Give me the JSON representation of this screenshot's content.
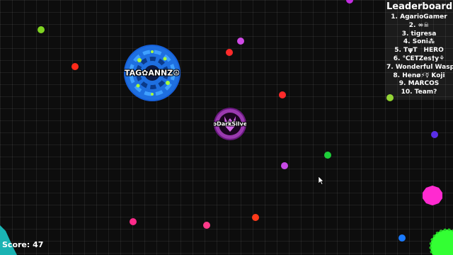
{
  "leaderboard": {
    "title": "Leaderboard",
    "entries": [
      "1. AgarioGamer",
      "2. ∞☠",
      "3. tigresa",
      "4. Soni⁂",
      "5. TψT HERO",
      "6. ℃ETZes†y⚘",
      "7. Wonderful Wasp",
      "8. Henø⚡☿ Koji",
      "9. MARCOS",
      "10. Team?"
    ]
  },
  "hud": {
    "score": "Score: 47"
  },
  "players": [
    {
      "name": "TAG✿ΑΝΝΖ☮",
      "color": "#1e6fe0"
    },
    {
      "name": "toDarkSilver",
      "color": "#9a3ab0"
    }
  ],
  "colors": {
    "background": "#0d0d0d",
    "virus": "#33ff33",
    "cursor": "#ffffff"
  },
  "icons": {
    "virus": "spiky-green-virus",
    "cursor": "mouse-pointer",
    "skin_1": "blue-swirl-skin",
    "skin_2": "purple-demon-skin"
  }
}
